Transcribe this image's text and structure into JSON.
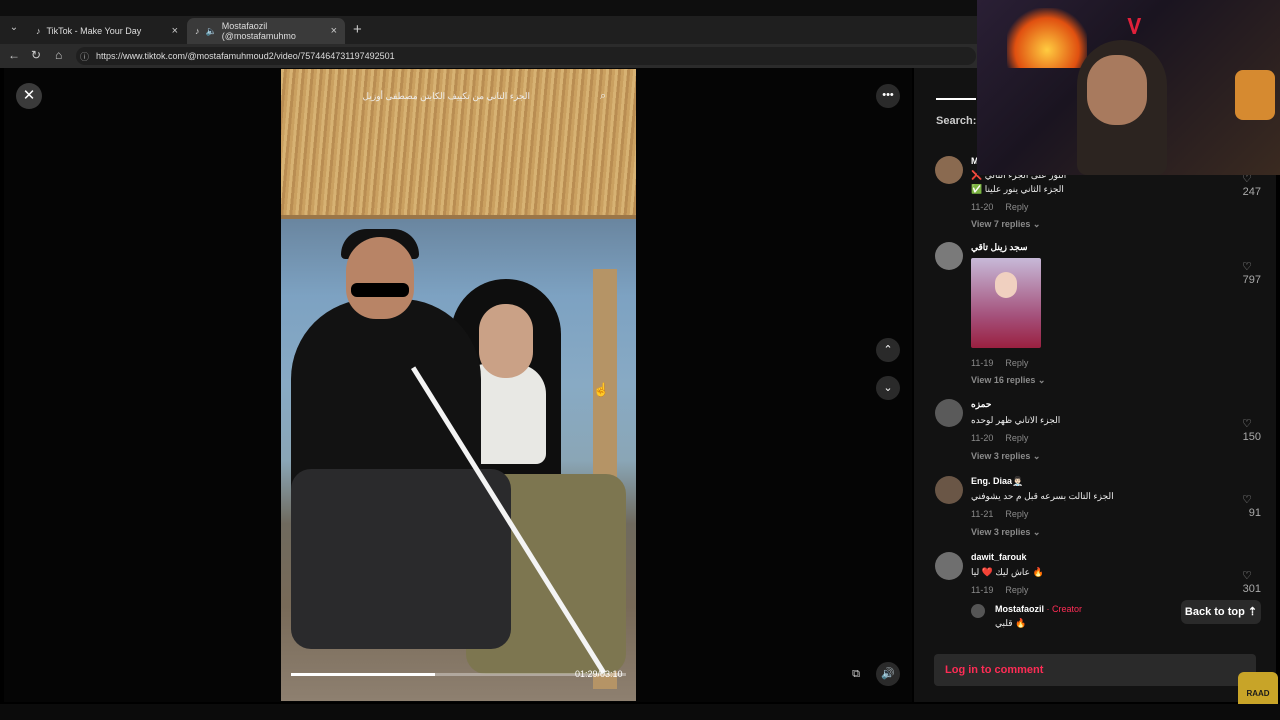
{
  "browser": {
    "tabs": [
      {
        "title": "TikTok - Make Your Day",
        "close": "×"
      },
      {
        "title": "Mostafaozil (@mostafamuhmo",
        "close": "×"
      }
    ],
    "new_tab": "+",
    "menu_icon": "⌄",
    "url": "https://www.tiktok.com/@mostafamuhmoud2/video/7574464731197492501"
  },
  "video": {
    "caption": "الجزء التاني من تكييف الكابتن مصطفى أوزيل",
    "time": "01:29/03:10",
    "progress": 0.43
  },
  "panel": {
    "search_label": "Search:",
    "back_to_top": "Back to top",
    "login": "Log in to comment"
  },
  "comments": [
    {
      "name": "M",
      "text1": "❌ النور على الجزء التالي",
      "text2": "✅ الجزء الثاني ينور علينا",
      "date": "11-20",
      "reply": "Reply",
      "replies": "View 7 replies",
      "likes": "247"
    },
    {
      "name": "سجد زينل تاقي",
      "date": "11-19",
      "reply": "Reply",
      "replies": "View 16 replies",
      "likes": "797"
    },
    {
      "name": "حمزه",
      "text1": "الجزء الاتاني ظهر لوحده",
      "date": "11-20",
      "reply": "Reply",
      "replies": "View 3 replies",
      "likes": "150"
    },
    {
      "name": "Eng. Diaa👨🏻‍⚕️",
      "text1": "الجزء التالت بسرعه قبل م حد يشوفني",
      "date": "11-21",
      "reply": "Reply",
      "replies": "View 3 replies",
      "likes": "91"
    },
    {
      "name": "dawit_farouk",
      "text1": "عاش ليك ❤️ ليا 🔥",
      "date": "11-19",
      "reply": "Reply",
      "likes": "301"
    }
  ],
  "creator_reply": {
    "name": "Mostafaozil",
    "badge": "· Creator",
    "text": "قلبي 🔥"
  },
  "watermark": "RAAD",
  "colors": {
    "accent": "#fe2c55",
    "panel": "#121212"
  }
}
